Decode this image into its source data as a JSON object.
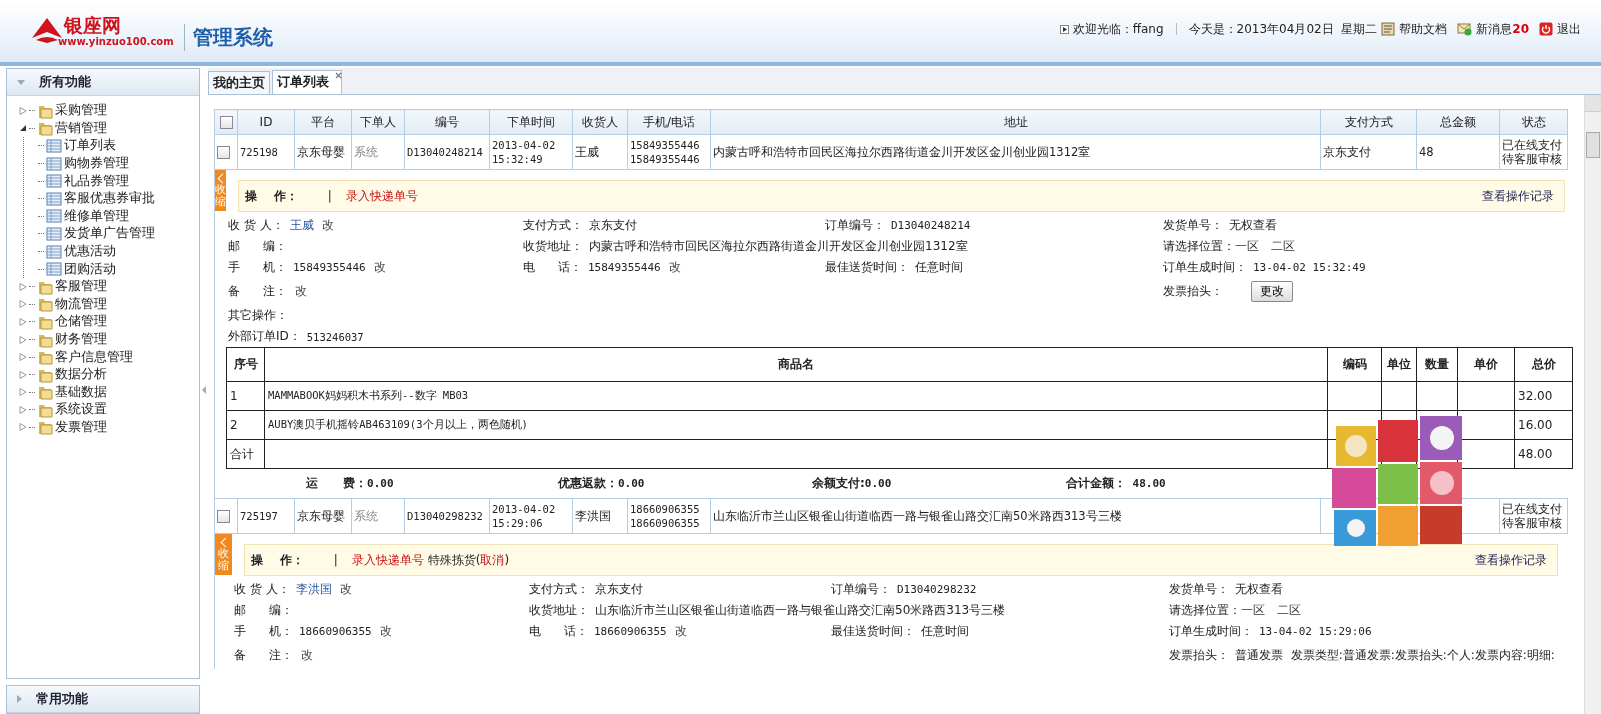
{
  "header": {
    "logo": {
      "name": "银座网",
      "url": "www.yinzuo100.com"
    },
    "system_title": "管理系统",
    "welcome": "欢迎光临：ffang",
    "date": "今天是：2013年04月02日  星期二",
    "help": "帮助文档",
    "messages": {
      "label": "新消息",
      "count": "20"
    },
    "logout": "退出"
  },
  "sidebar": {
    "panels": [
      {
        "title": "所有功能",
        "expanded": true,
        "tree": [
          {
            "label": "采购管理",
            "expanded": false
          },
          {
            "label": "营销管理",
            "expanded": true,
            "children": [
              {
                "label": "订单列表"
              },
              {
                "label": "购物券管理"
              },
              {
                "label": "礼品券管理"
              },
              {
                "label": "客服优惠券审批"
              },
              {
                "label": "维修单管理"
              },
              {
                "label": "发货单广告管理"
              },
              {
                "label": "优惠活动"
              },
              {
                "label": "团购活动"
              }
            ]
          },
          {
            "label": "客服管理",
            "expanded": false
          },
          {
            "label": "物流管理",
            "expanded": false
          },
          {
            "label": "仓储管理",
            "expanded": false
          },
          {
            "label": "财务管理",
            "expanded": false
          },
          {
            "label": "客户信息管理",
            "expanded": false
          },
          {
            "label": "数据分析",
            "expanded": false
          },
          {
            "label": "基础数据",
            "expanded": false
          },
          {
            "label": "系统设置",
            "expanded": false
          },
          {
            "label": "发票管理",
            "expanded": false
          }
        ]
      },
      {
        "title": "常用功能",
        "expanded": false
      }
    ]
  },
  "tabs": [
    {
      "label": "我的主页",
      "selected": false,
      "closable": false
    },
    {
      "label": "订单列表",
      "selected": true,
      "closable": true
    }
  ],
  "orders_table": {
    "select_all": {
      "checked": false
    },
    "columns": [
      "ID",
      "平台",
      "下单人",
      "编号",
      "下单时间",
      "收货人",
      "手机/电话",
      "地址",
      "支付方式",
      "总金额",
      "状态"
    ],
    "orders": [
      {
        "checked": false,
        "id": "725198",
        "platform": "京东母婴",
        "orderer": "系统",
        "number": "D13040248214",
        "time": [
          "2013-04-02",
          "15:32:49"
        ],
        "receiver": "王威",
        "phones": [
          "15849355446",
          "15849355446"
        ],
        "address": "内蒙古呼和浩特市回民区海拉尔西路街道金川开发区金川创业园1312室",
        "payment": "京东支付",
        "amount": "48",
        "status": [
          "已在线支付",
          "待客服审核"
        ],
        "detail": {
          "expanded": true,
          "toggle": "收缩",
          "op_label": "操    作：",
          "op_sep": "|",
          "ops": [
            {
              "kind": "link",
              "text": "录入快递单号"
            }
          ],
          "log_link": "查看操作记录",
          "fields": [
            {
              "left": {
                "label": "收 货 人：",
                "value": "王威",
                "kind": "name",
                "edit": "改"
              },
              "mid_left": {
                "label": "支付方式：",
                "value": "京东支付"
              },
              "mid_right": {
                "label": "订单编号：",
                "value": "D13040248214",
                "kind": "code"
              },
              "right": {
                "label": "发货单号：",
                "value": "无权查看"
              }
            },
            {
              "left": {
                "label": "邮      编："
              },
              "mid_left": {
                "label": "收货地址：",
                "value": "内蒙古呼和浩特市回民区海拉尔西路街道金川开发区金川创业园1312室"
              },
              "right": {
                "label": "请选择位置：",
                "links": [
                  "一区",
                  "二区"
                ]
              }
            },
            {
              "left": {
                "label": "手      机：",
                "value": "15849355446",
                "kind": "code",
                "edit": "改"
              },
              "mid_left": {
                "label": "电      话：",
                "value": "15849355446",
                "kind": "code",
                "edit": "改"
              },
              "mid_right": {
                "label": "最佳送货时间：",
                "value": "任意时间"
              },
              "right": {
                "label": "订单生成时间：",
                "value": "13-04-02 15:32:49",
                "kind": "code"
              }
            },
            {
              "left": {
                "label": "备      注：",
                "edit": "改"
              },
              "right": {
                "label": "发票抬头：",
                "button": "更改"
              }
            }
          ],
          "other_ops": "其它操作：",
          "external_id": {
            "label": "外部订单ID：",
            "value": "513246037"
          },
          "items": {
            "columns": [
              "序号",
              "商品名",
              "编码",
              "单位",
              "数量",
              "单价",
              "总价"
            ],
            "rows": [
              {
                "no": "1",
                "name": "MAMMABOOK妈妈积木书系列--数字 MB03",
                "total": "32.00"
              },
              {
                "no": "2",
                "name": "AUBY澳贝手机摇铃AB463109(3个月以上，两色随机)",
                "total": "16.00"
              }
            ],
            "sum_row": {
              "label": "合计",
              "total": "48.00"
            }
          },
          "summary": [
            {
              "label": "运      费：",
              "value": "0.00"
            },
            {
              "label": "优惠返款：",
              "value": "0.00"
            },
            {
              "label": "余额支付:",
              "value": "0.00"
            },
            {
              "label": "合计金额：",
              "value": " 48.00"
            }
          ]
        }
      },
      {
        "checked": false,
        "id": "725197",
        "platform": "京东母婴",
        "orderer": "系统",
        "number": "D13040298232",
        "time": [
          "2013-04-02",
          "15:29:06"
        ],
        "receiver": "李洪国",
        "phones": [
          "18660906355",
          "18660906355"
        ],
        "address": "山东临沂市兰山区银雀山街道临西一路与银雀山路交汇南50米路西313号三楼",
        "status": [
          "已在线支付",
          "待客服审核"
        ],
        "detail": {
          "expanded": true,
          "toggle": "收缩",
          "op_label": "操    作：",
          "op_sep": "|",
          "ops": [
            {
              "kind": "link",
              "text": "录入快递单号"
            },
            {
              "kind": "note",
              "parts": [
                "特殊拣货(",
                "取消",
                ")"
              ]
            }
          ],
          "log_link": "查看操作记录",
          "fields": [
            {
              "left": {
                "label": "收 货 人：",
                "value": "李洪国",
                "kind": "name",
                "edit": "改"
              },
              "mid_left": {
                "label": "支付方式：",
                "value": "京东支付"
              },
              "mid_right": {
                "label": "订单编号：",
                "value": "D13040298232",
                "kind": "code"
              },
              "right": {
                "label": "发货单号：",
                "value": "无权查看"
              }
            },
            {
              "left": {
                "label": "邮      编："
              },
              "mid_left": {
                "label": "收货地址：",
                "value": "山东临沂市兰山区银雀山街道临西一路与银雀山路交汇南50米路西313号三楼"
              },
              "right": {
                "label": "请选择位置：",
                "links": [
                  "一区",
                  "二区"
                ]
              }
            },
            {
              "left": {
                "label": "手      机：",
                "value": "18660906355",
                "kind": "code",
                "edit": "改"
              },
              "mid_left": {
                "label": "电      话：",
                "value": "18660906355",
                "kind": "code",
                "edit": "改"
              },
              "mid_right": {
                "label": "最佳送货时间：",
                "value": "任意时间"
              },
              "right": {
                "label": "订单生成时间：",
                "value": "13-04-02 15:29:06",
                "kind": "code"
              }
            },
            {
              "left": {
                "label": "备      注：",
                "edit": "改"
              },
              "right": {
                "label": "发票抬头：",
                "value": "普通发票  发票类型:普通发票:发票抬头:个人:发票内容:明细:"
              }
            }
          ]
        }
      }
    ]
  }
}
